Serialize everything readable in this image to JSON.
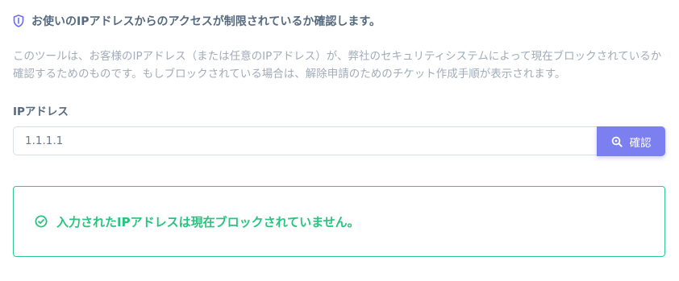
{
  "header": {
    "icon": "shield-icon",
    "title": "お使いのIPアドレスからのアクセスが制限されているか確認します。"
  },
  "description": "このツールは、お客様のIPアドレス（または任意のIPアドレス）が、弊社のセキュリティシステムによって現在ブロックされているか確認するためのものです。もしブロックされている場合は、解除申請のためのチケット作成手順が表示されます。",
  "form": {
    "ip_label": "IPアドレス",
    "ip_value": "1.1.1.1",
    "submit_label": "確認",
    "submit_icon": "search-icon"
  },
  "result": {
    "icon": "check-circle-icon",
    "message": "入力されたIPアドレスは現在ブロックされていません。"
  },
  "colors": {
    "accent": "#7b7ff0",
    "success": "#28c47f",
    "success_border": "#2fc78f",
    "text": "#566a7f",
    "muted": "#a1acb8"
  }
}
